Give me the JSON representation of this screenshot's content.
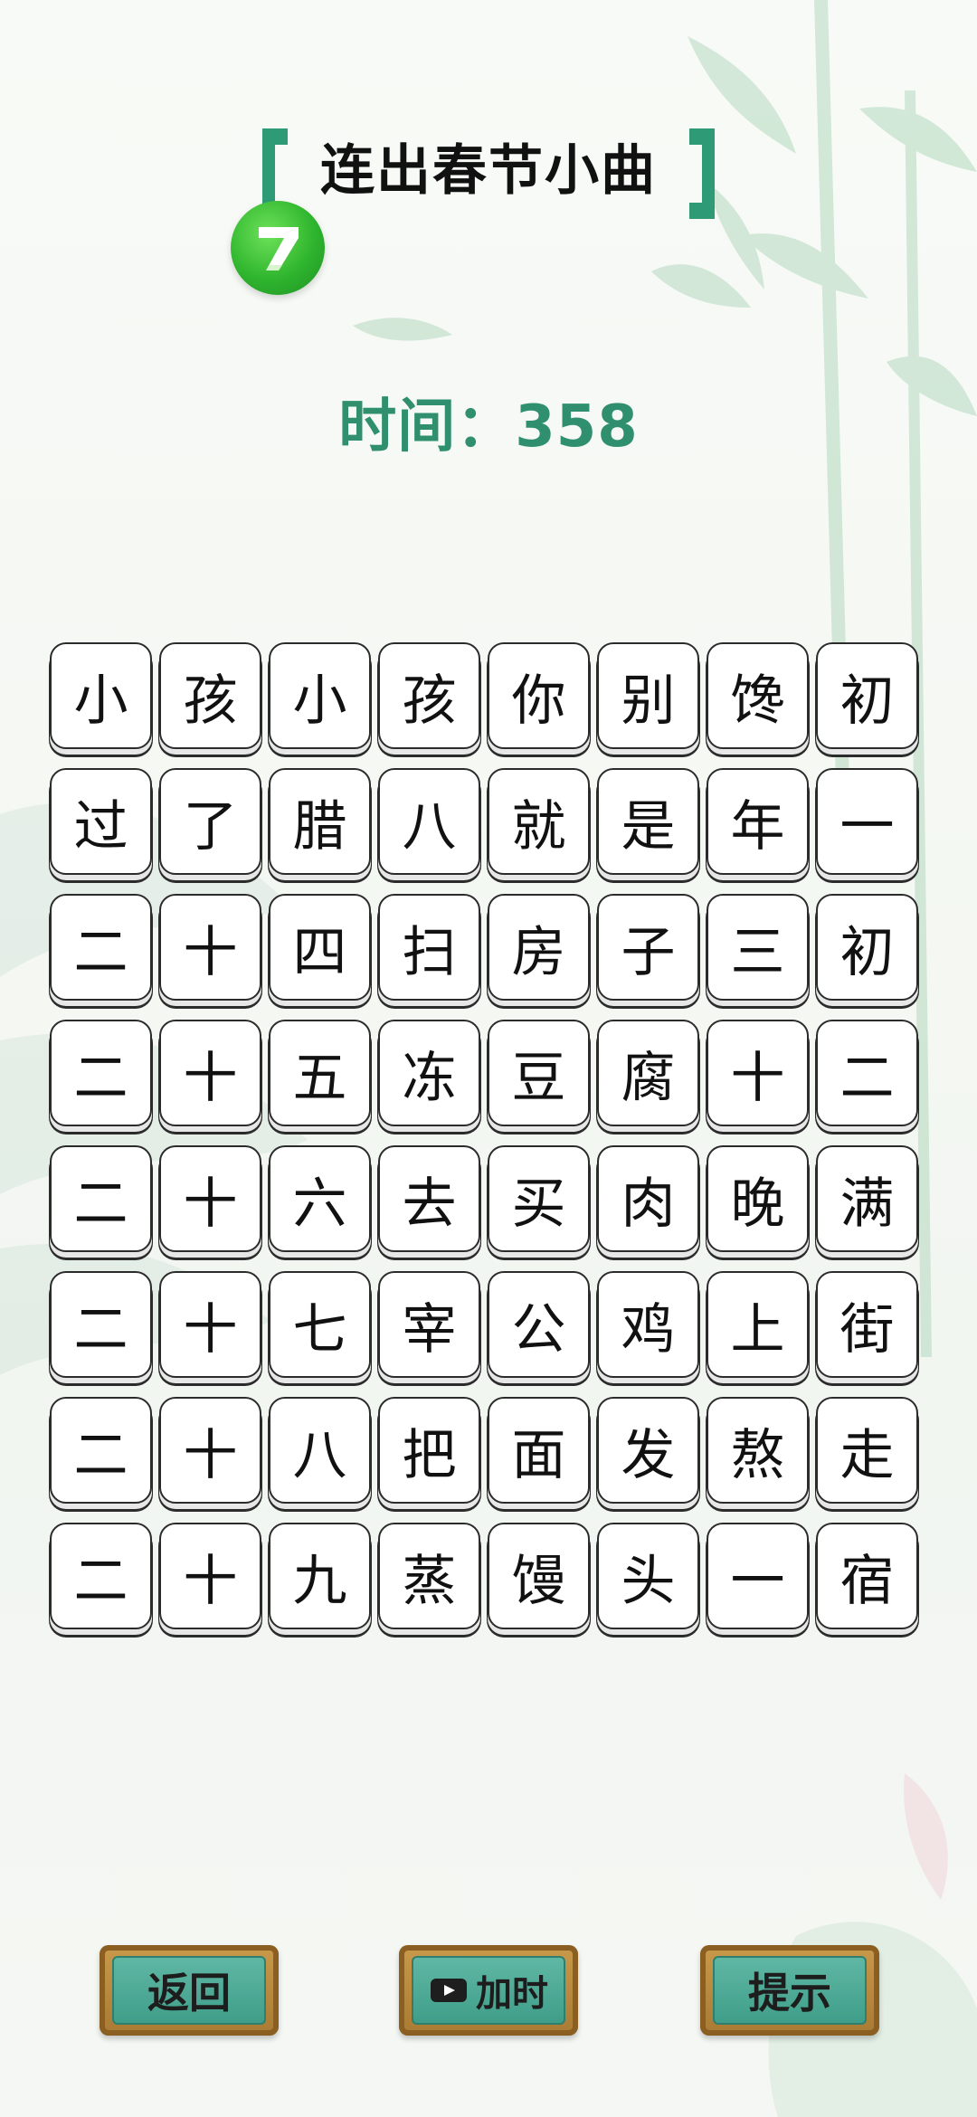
{
  "title": "连出春节小曲",
  "timer": {
    "label": "时间：",
    "value": "358"
  },
  "tiles": [
    "小",
    "孩",
    "小",
    "孩",
    "你",
    "别",
    "馋",
    "初",
    "过",
    "了",
    "腊",
    "八",
    "就",
    "是",
    "年",
    "一",
    "二",
    "十",
    "四",
    "扫",
    "房",
    "子",
    "三",
    "初",
    "二",
    "十",
    "五",
    "冻",
    "豆",
    "腐",
    "十",
    "二",
    "二",
    "十",
    "六",
    "去",
    "买",
    "肉",
    "晚",
    "满",
    "二",
    "十",
    "七",
    "宰",
    "公",
    "鸡",
    "上",
    "街",
    "二",
    "十",
    "八",
    "把",
    "面",
    "发",
    "熬",
    "走",
    "二",
    "十",
    "九",
    "蒸",
    "馒",
    "头",
    "一",
    "宿"
  ],
  "buttons": {
    "back": "返回",
    "add_time": "加时",
    "hint": "提示"
  },
  "colors": {
    "accent": "#2f8f6f",
    "button_frame": "#a87a33",
    "button_face": "#4aa894"
  },
  "icons": {
    "logo": "green-7-badge-icon",
    "video": "video-camera-icon"
  }
}
